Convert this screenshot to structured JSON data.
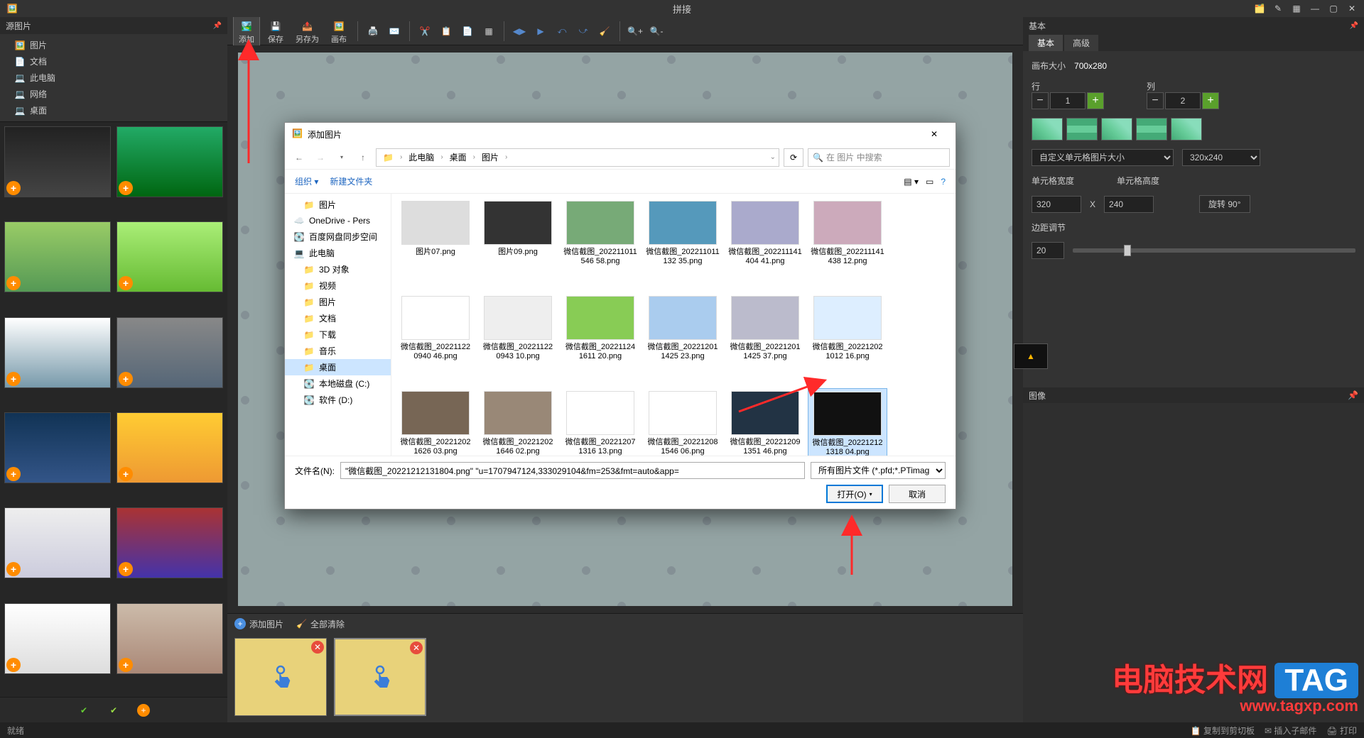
{
  "titlebar": {
    "title": "拼接"
  },
  "leftPanel": {
    "header": "源图片",
    "tree": [
      {
        "label": "图片",
        "icon": "folder"
      },
      {
        "label": "文档",
        "icon": "doc"
      },
      {
        "label": "此电脑",
        "icon": "pc"
      },
      {
        "label": "网络",
        "icon": "pc"
      },
      {
        "label": "桌面",
        "icon": "pc"
      }
    ]
  },
  "toolbar": {
    "add": "添加",
    "save": "保存",
    "saveAs": "另存为",
    "canvas": "画布"
  },
  "bottomStrip": {
    "addImage": "添加图片",
    "clearAll": "全部清除"
  },
  "rightPanel": {
    "header": "基本",
    "tabs": {
      "basic": "基本",
      "advanced": "高级"
    },
    "canvasSizeLabel": "画布大小",
    "canvasSizeValue": "700x280",
    "rowsLabel": "行",
    "colsLabel": "列",
    "rowsValue": "1",
    "colsValue": "2",
    "cellSizeLabel": "自定义单元格图片大小",
    "cellSizeSelect": "320x240",
    "cellWidthLabel": "单元格宽度",
    "cellHeightLabel": "单元格高度",
    "cellWidthValue": "320",
    "cellHeightValue": "240",
    "xSep": "X",
    "rotateLabel": "旋转 90°",
    "spacingLabel": "边距调节",
    "spacingValue": "20",
    "imageHeader": "图像"
  },
  "fileDialog": {
    "title": "添加图片",
    "path": [
      "此电脑",
      "桌面",
      "图片"
    ],
    "searchPlaceholder": "在 图片 中搜索",
    "organize": "组织",
    "newFolder": "新建文件夹",
    "tree": [
      {
        "label": "图片",
        "icon": "folder",
        "indent": 1
      },
      {
        "label": "OneDrive - Pers",
        "icon": "cloud",
        "indent": 0
      },
      {
        "label": "百度网盘同步空间",
        "icon": "disk",
        "indent": 0
      },
      {
        "label": "此电脑",
        "icon": "pc",
        "indent": 0
      },
      {
        "label": "3D 对象",
        "icon": "folder",
        "indent": 1
      },
      {
        "label": "视频",
        "icon": "folder",
        "indent": 1
      },
      {
        "label": "图片",
        "icon": "folder",
        "indent": 1
      },
      {
        "label": "文档",
        "icon": "folder",
        "indent": 1
      },
      {
        "label": "下载",
        "icon": "folder",
        "indent": 1
      },
      {
        "label": "音乐",
        "icon": "folder",
        "indent": 1
      },
      {
        "label": "桌面",
        "icon": "folder",
        "indent": 1,
        "selected": true
      },
      {
        "label": "本地磁盘 (C:)",
        "icon": "disk",
        "indent": 1
      },
      {
        "label": "软件 (D:)",
        "icon": "disk",
        "indent": 1
      }
    ],
    "files": [
      {
        "name": "图片07.png"
      },
      {
        "name": "图片09.png"
      },
      {
        "name": "微信截图_202211011546 58.png"
      },
      {
        "name": "微信截图_202211011132 35.png"
      },
      {
        "name": "微信截图_202211141404 41.png"
      },
      {
        "name": "微信截图_202211141438 12.png"
      },
      {
        "name": "微信截图_202211220940 46.png"
      },
      {
        "name": "微信截图_202211220943 10.png"
      },
      {
        "name": "微信截图_202211241611 20.png"
      },
      {
        "name": "微信截图_202212011425 23.png"
      },
      {
        "name": "微信截图_202212011425 37.png"
      },
      {
        "name": "微信截图_202212021012 16.png"
      },
      {
        "name": "微信截图_202212021626 03.png"
      },
      {
        "name": "微信截图_202212021646 02.png"
      },
      {
        "name": "微信截图_202212071316 13.png"
      },
      {
        "name": "微信截图_202212081546 06.png"
      },
      {
        "name": "微信截图_202212091351 46.png"
      },
      {
        "name": "微信截图_202212121318 04.png",
        "selected": true
      }
    ],
    "fileNameLabel": "文件名(N):",
    "fileNameValue": "\"微信截图_20221212131804.png\" \"u=1707947124,333029104&fm=253&fmt=auto&app=",
    "filterValue": "所有图片文件 (*.pfd;*.PTimag",
    "openBtn": "打开(O)",
    "cancelBtn": "取消"
  },
  "statusbar": {
    "ready": "就绪",
    "copyTo": "复制到剪切板",
    "insert": "插入子邮件",
    "print": "打印"
  },
  "watermark": {
    "main": "电脑技术网",
    "tag": "TAG",
    "url": "www.tagxp.com"
  }
}
